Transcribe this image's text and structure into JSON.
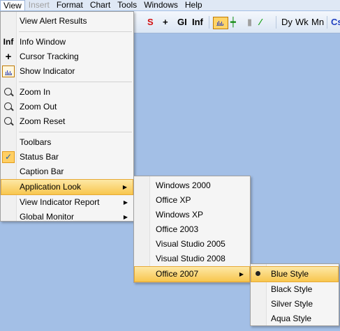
{
  "menubar": {
    "items": [
      "View",
      "Insert",
      "Format",
      "Chart",
      "Tools",
      "Windows",
      "Help"
    ]
  },
  "toolbar": {
    "s": "S",
    "plus": "+",
    "gi": "GI",
    "inf": "Inf",
    "dy": "Dy",
    "wk": "Wk",
    "mn": "Mn",
    "cs": "Cs"
  },
  "view_menu": {
    "view_alert_results": "View Alert Results",
    "info_window": "Info Window",
    "cursor_tracking": "Cursor Tracking",
    "show_indicator": "Show Indicator",
    "zoom_in": "Zoom In",
    "zoom_out": "Zoom Out",
    "zoom_reset": "Zoom Reset",
    "toolbars": "Toolbars",
    "status_bar": "Status Bar",
    "caption_bar": "Caption Bar",
    "application_look": "Application Look",
    "view_indicator_report": "View Indicator Report",
    "global_monitor": "Global Monitor",
    "info_icon_text": "Inf",
    "cursor_icon_text": "+"
  },
  "look_menu": {
    "items": [
      "Windows 2000",
      "Office XP",
      "Windows XP",
      "Office 2003",
      "Visual Studio 2005",
      "Visual Studio 2008",
      "Office 2007"
    ]
  },
  "office2007_menu": {
    "items": [
      "Blue Style",
      "Black Style",
      "Silver Style",
      "Aqua Style"
    ],
    "selected": "Blue Style"
  },
  "colors": {
    "background": "#a3bfe6",
    "highlight": "#f8c64e"
  }
}
